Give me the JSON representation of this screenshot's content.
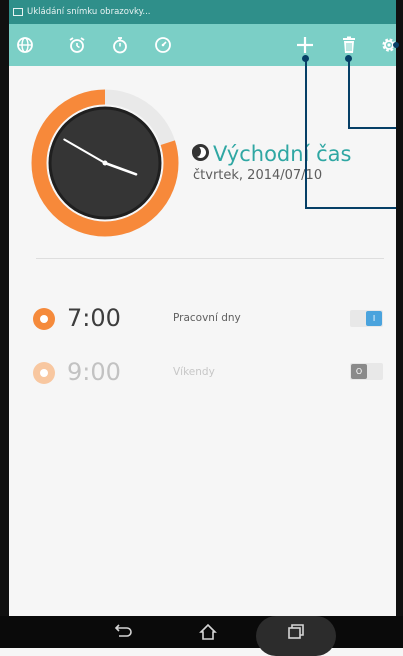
{
  "status_bar": {
    "notification_text": "Ukládání snímku obrazovky..."
  },
  "app_bar": {
    "tabs": [
      "world-clock-icon",
      "alarm-icon",
      "stopwatch-icon",
      "timer-icon"
    ],
    "actions": [
      "add-icon",
      "delete-icon",
      "settings-icon"
    ]
  },
  "clock": {
    "time_zone_name": "Východní čas",
    "date": "čtvrtek, 2014/07/10",
    "hour_hand_deg": 110,
    "minute_hand_deg": 300,
    "progress_fraction": 0.8
  },
  "alarms": [
    {
      "time": "7:00",
      "days": "Pracovní dny",
      "enabled": true,
      "toggle_label": "I"
    },
    {
      "time": "9:00",
      "days": "Víkendy",
      "enabled": false,
      "toggle_label": "O"
    }
  ],
  "colors": {
    "teal_header": "#7bcfc6",
    "accent_orange": "#f7893a",
    "teal_text": "#2fa7a3",
    "callout_navy": "#063f66",
    "toggle_on": "#4aa3dd"
  }
}
